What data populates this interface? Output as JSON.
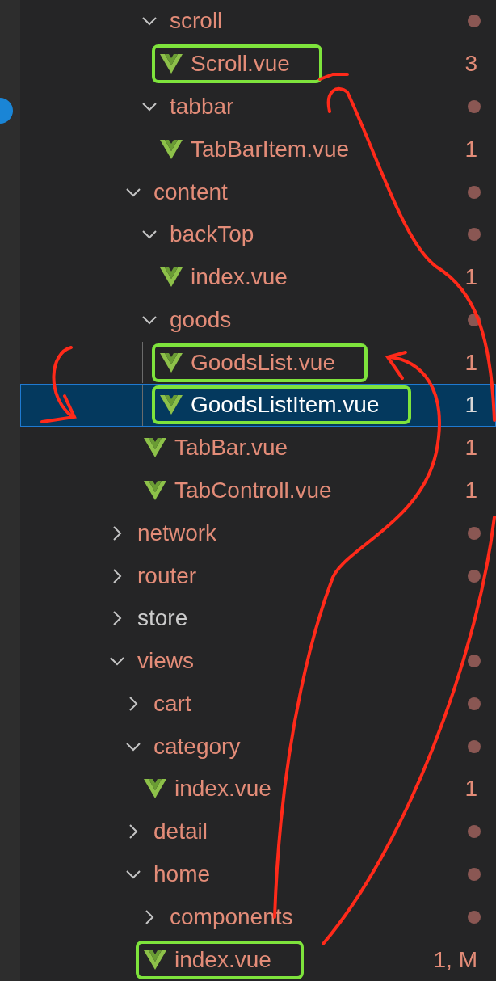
{
  "tree": [
    {
      "children": [
        {
          "children": [
            {
              "kind": "folder",
              "label": "scroll",
              "expanded": true,
              "problems": true,
              "children": [
                {
                  "kind": "file",
                  "label": "Scroll.vue",
                  "problems": true,
                  "badge": "3",
                  "selected": false,
                  "highlighted": true
                }
              ]
            },
            {
              "kind": "folder",
              "label": "tabbar",
              "expanded": true,
              "problems": true,
              "children": [
                {
                  "kind": "file",
                  "label": "TabBarItem.vue",
                  "problems": true,
                  "badge": "1",
                  "selected": false,
                  "highlighted": false
                }
              ]
            }
          ]
        },
        {
          "kind": "folder",
          "label": "content",
          "expanded": true,
          "problems": true,
          "children": [
            {
              "kind": "folder",
              "label": "backTop",
              "expanded": true,
              "problems": true,
              "children": [
                {
                  "kind": "file",
                  "label": "index.vue",
                  "problems": true,
                  "badge": "1",
                  "selected": false,
                  "highlighted": false
                }
              ]
            },
            {
              "kind": "folder",
              "label": "goods",
              "expanded": true,
              "problems": true,
              "children": [
                {
                  "kind": "file",
                  "label": "GoodsList.vue",
                  "problems": true,
                  "badge": "1",
                  "selected": false,
                  "highlighted": true
                },
                {
                  "kind": "file",
                  "label": "GoodsListItem.vue",
                  "problems": true,
                  "badge": "1",
                  "selected": true,
                  "highlighted": true
                }
              ]
            },
            {
              "kind": "file",
              "label": "TabBar.vue",
              "problems": true,
              "badge": "1",
              "selected": false,
              "highlighted": false
            },
            {
              "kind": "file",
              "label": "TabControll.vue",
              "problems": true,
              "badge": "1",
              "selected": false,
              "highlighted": false
            }
          ]
        }
      ]
    },
    {
      "kind": "folder",
      "label": "network",
      "expanded": false,
      "problems": true
    },
    {
      "kind": "folder",
      "label": "router",
      "expanded": false,
      "problems": true
    },
    {
      "kind": "folder",
      "label": "store",
      "expanded": false,
      "problems": false
    },
    {
      "kind": "folder",
      "label": "views",
      "expanded": true,
      "problems": true,
      "children": [
        {
          "kind": "folder",
          "label": "cart",
          "expanded": false,
          "problems": true
        },
        {
          "kind": "folder",
          "label": "category",
          "expanded": true,
          "problems": true,
          "children": [
            {
              "kind": "file",
              "label": "index.vue",
              "problems": true,
              "badge": "1",
              "selected": false,
              "highlighted": false
            }
          ]
        },
        {
          "kind": "folder",
          "label": "detail",
          "expanded": false,
          "problems": true
        },
        {
          "kind": "folder",
          "label": "home",
          "expanded": true,
          "problems": true,
          "children": [
            {
              "kind": "folder",
              "label": "components",
              "expanded": false,
              "problems": true
            },
            {
              "kind": "file",
              "label": "index.vue",
              "problems": true,
              "badge": "1, M",
              "selected": false,
              "highlighted": true
            }
          ]
        }
      ]
    }
  ]
}
